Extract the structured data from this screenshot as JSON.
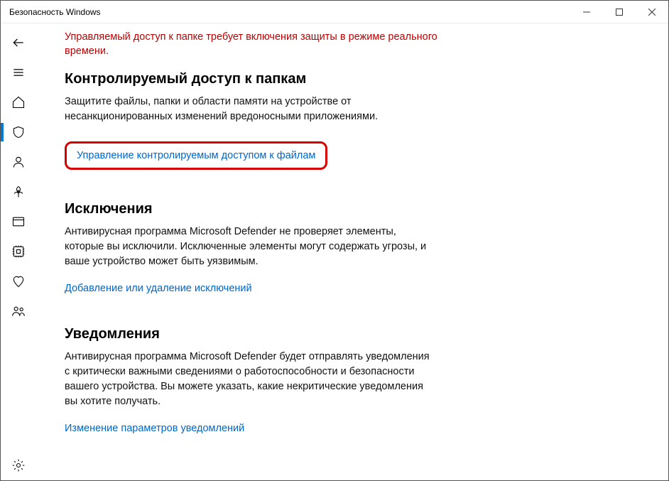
{
  "window": {
    "title": "Безопасность Windows"
  },
  "nav": {
    "back": "back",
    "menu": "menu",
    "home": "home",
    "protection": "virus-protection",
    "account": "account-protection",
    "firewall": "firewall",
    "appbrowser": "app-browser",
    "device": "device-security",
    "health": "device-health",
    "family": "family-options",
    "settings": "settings"
  },
  "warning": "Управляемый доступ к папке требует включения защиты в режиме реального времени.",
  "sections": {
    "controlled": {
      "title": "Контролируемый доступ к папкам",
      "desc": "Защитите файлы, папки и области памяти на устройстве от несанкционированных изменений вредоносными приложениями.",
      "link": "Управление контролируемым доступом к файлам"
    },
    "exclusions": {
      "title": "Исключения",
      "desc": "Антивирусная программа Microsoft Defender не проверяет элементы, которые вы исключили. Исключенные элементы могут содержать угрозы, и ваше устройство может быть уязвимым.",
      "link": "Добавление или удаление исключений"
    },
    "notifications": {
      "title": "Уведомления",
      "desc": "Антивирусная программа Microsoft Defender будет отправлять уведомления с критически важными сведениями о работоспособности и безопасности вашего устройства. Вы можете указать, какие некритические уведомления вы хотите получать.",
      "link": "Изменение параметров уведомлений"
    }
  }
}
